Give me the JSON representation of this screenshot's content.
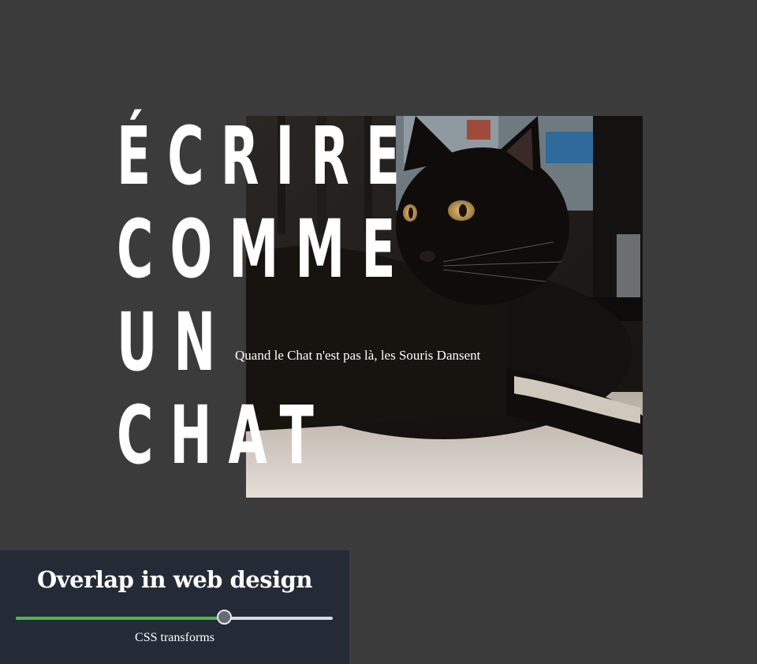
{
  "headline": {
    "lines": [
      "ÉCRIRE",
      "COMME",
      "UN",
      "CHAT"
    ]
  },
  "caption": "Quand le Chat n'est pas là, les Souris Dansent",
  "photo": {
    "subject": "black cat lying on a windowsill"
  },
  "widget": {
    "title": "Overlap in web design",
    "slider": {
      "label": "CSS transforms",
      "value": 0.66,
      "fill_color": "#4fb84a",
      "track_color": "#d9dbe0",
      "thumb_color": "#656a78"
    }
  },
  "colors": {
    "background": "#3b3b3c",
    "widget_background": "#242b36",
    "text": "#ffffff"
  }
}
